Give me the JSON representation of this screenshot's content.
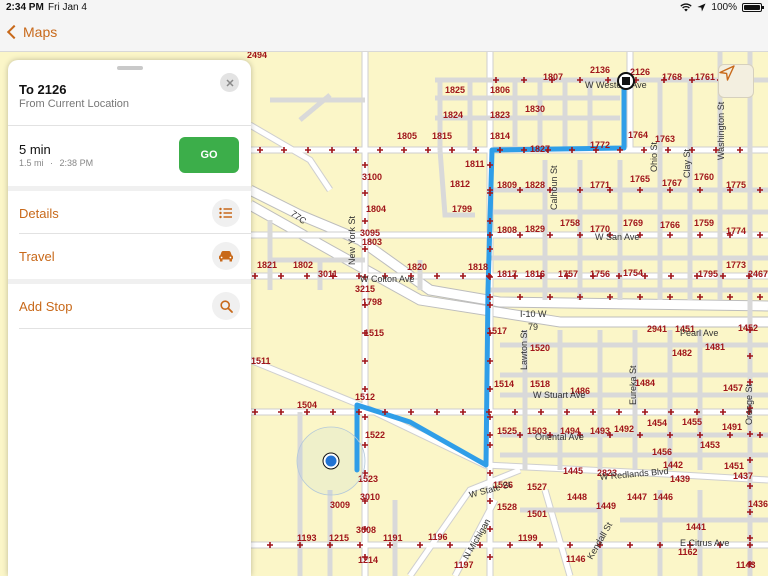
{
  "status_bar": {
    "time": "2:34 PM",
    "date": "Fri Jan 4",
    "battery": "100%",
    "battery_level": 1.0
  },
  "nav": {
    "back_label": "Maps"
  },
  "panel": {
    "title": "To 2126",
    "subtitle": "From Current Location",
    "eta": "5 min",
    "eta_distance": "1.5 mi",
    "eta_separator": "·",
    "eta_arrival": "2:38 PM",
    "go_label": "GO",
    "rows": [
      {
        "label": "Details",
        "icon": "list-icon"
      },
      {
        "label": "Travel",
        "icon": "car-icon"
      },
      {
        "label": "Add Stop",
        "icon": "search-icon"
      }
    ]
  },
  "colors": {
    "accent": "#c8691a",
    "go": "#3cae4a",
    "route": "#2f9ee8",
    "map_bg": "#fbf6c8",
    "label": "#a0151a"
  },
  "map": {
    "street_labels": [
      "W Western Ave",
      "W Colton Ave",
      "W San Ave",
      "I-10 W",
      "79",
      "W Stuart Ave",
      "Oriental Ave",
      "W Redlands Blvd",
      "W State St",
      "E Citrus Ave",
      "Calhoun St",
      "Lawton St",
      "Eureka St",
      "Orange St",
      "Washington St",
      "Clay St",
      "Ohio St",
      "Pearl Ave",
      "N Michigan",
      "Kendall St",
      "77C",
      "New York St"
    ],
    "parcel_labels": [
      "2494",
      "1807",
      "2136",
      "2126",
      "1768",
      "1761",
      "1825",
      "1806",
      "1830",
      "1824",
      "1823",
      "1805",
      "1815",
      "1814",
      "1827",
      "1772",
      "1764",
      "1763",
      "1811",
      "1765",
      "1812",
      "1809",
      "1828",
      "1771",
      "1767",
      "1760",
      "1775",
      "3100",
      "1799",
      "1804",
      "1758",
      "3095",
      "1803",
      "1808",
      "1829",
      "1770",
      "1769",
      "1766",
      "1759",
      "1774",
      "1821",
      "1802",
      "3011",
      "1820",
      "1818",
      "1817",
      "1816",
      "1757",
      "1756",
      "1754",
      "1795",
      "1773",
      "2467",
      "3215",
      "1798",
      "1515",
      "1517",
      "2941",
      "1451",
      "1452",
      "1520",
      "1482",
      "1481",
      "1511",
      "1514",
      "1518",
      "1486",
      "1484",
      "1457",
      "1504",
      "1512",
      "1522",
      "1525",
      "1503",
      "1494",
      "1493",
      "1492",
      "1454",
      "1455",
      "1491",
      "1453",
      "1456",
      "1442",
      "1451",
      "1445",
      "2823",
      "1439",
      "1437",
      "1523",
      "3010",
      "1526",
      "1527",
      "1448",
      "1447",
      "1446",
      "3009",
      "1528",
      "1501",
      "1449",
      "1436",
      "3008",
      "1193",
      "1215",
      "1191",
      "1196",
      "1199",
      "1441",
      "1214",
      "1197",
      "1146",
      "1162",
      "1143"
    ]
  }
}
